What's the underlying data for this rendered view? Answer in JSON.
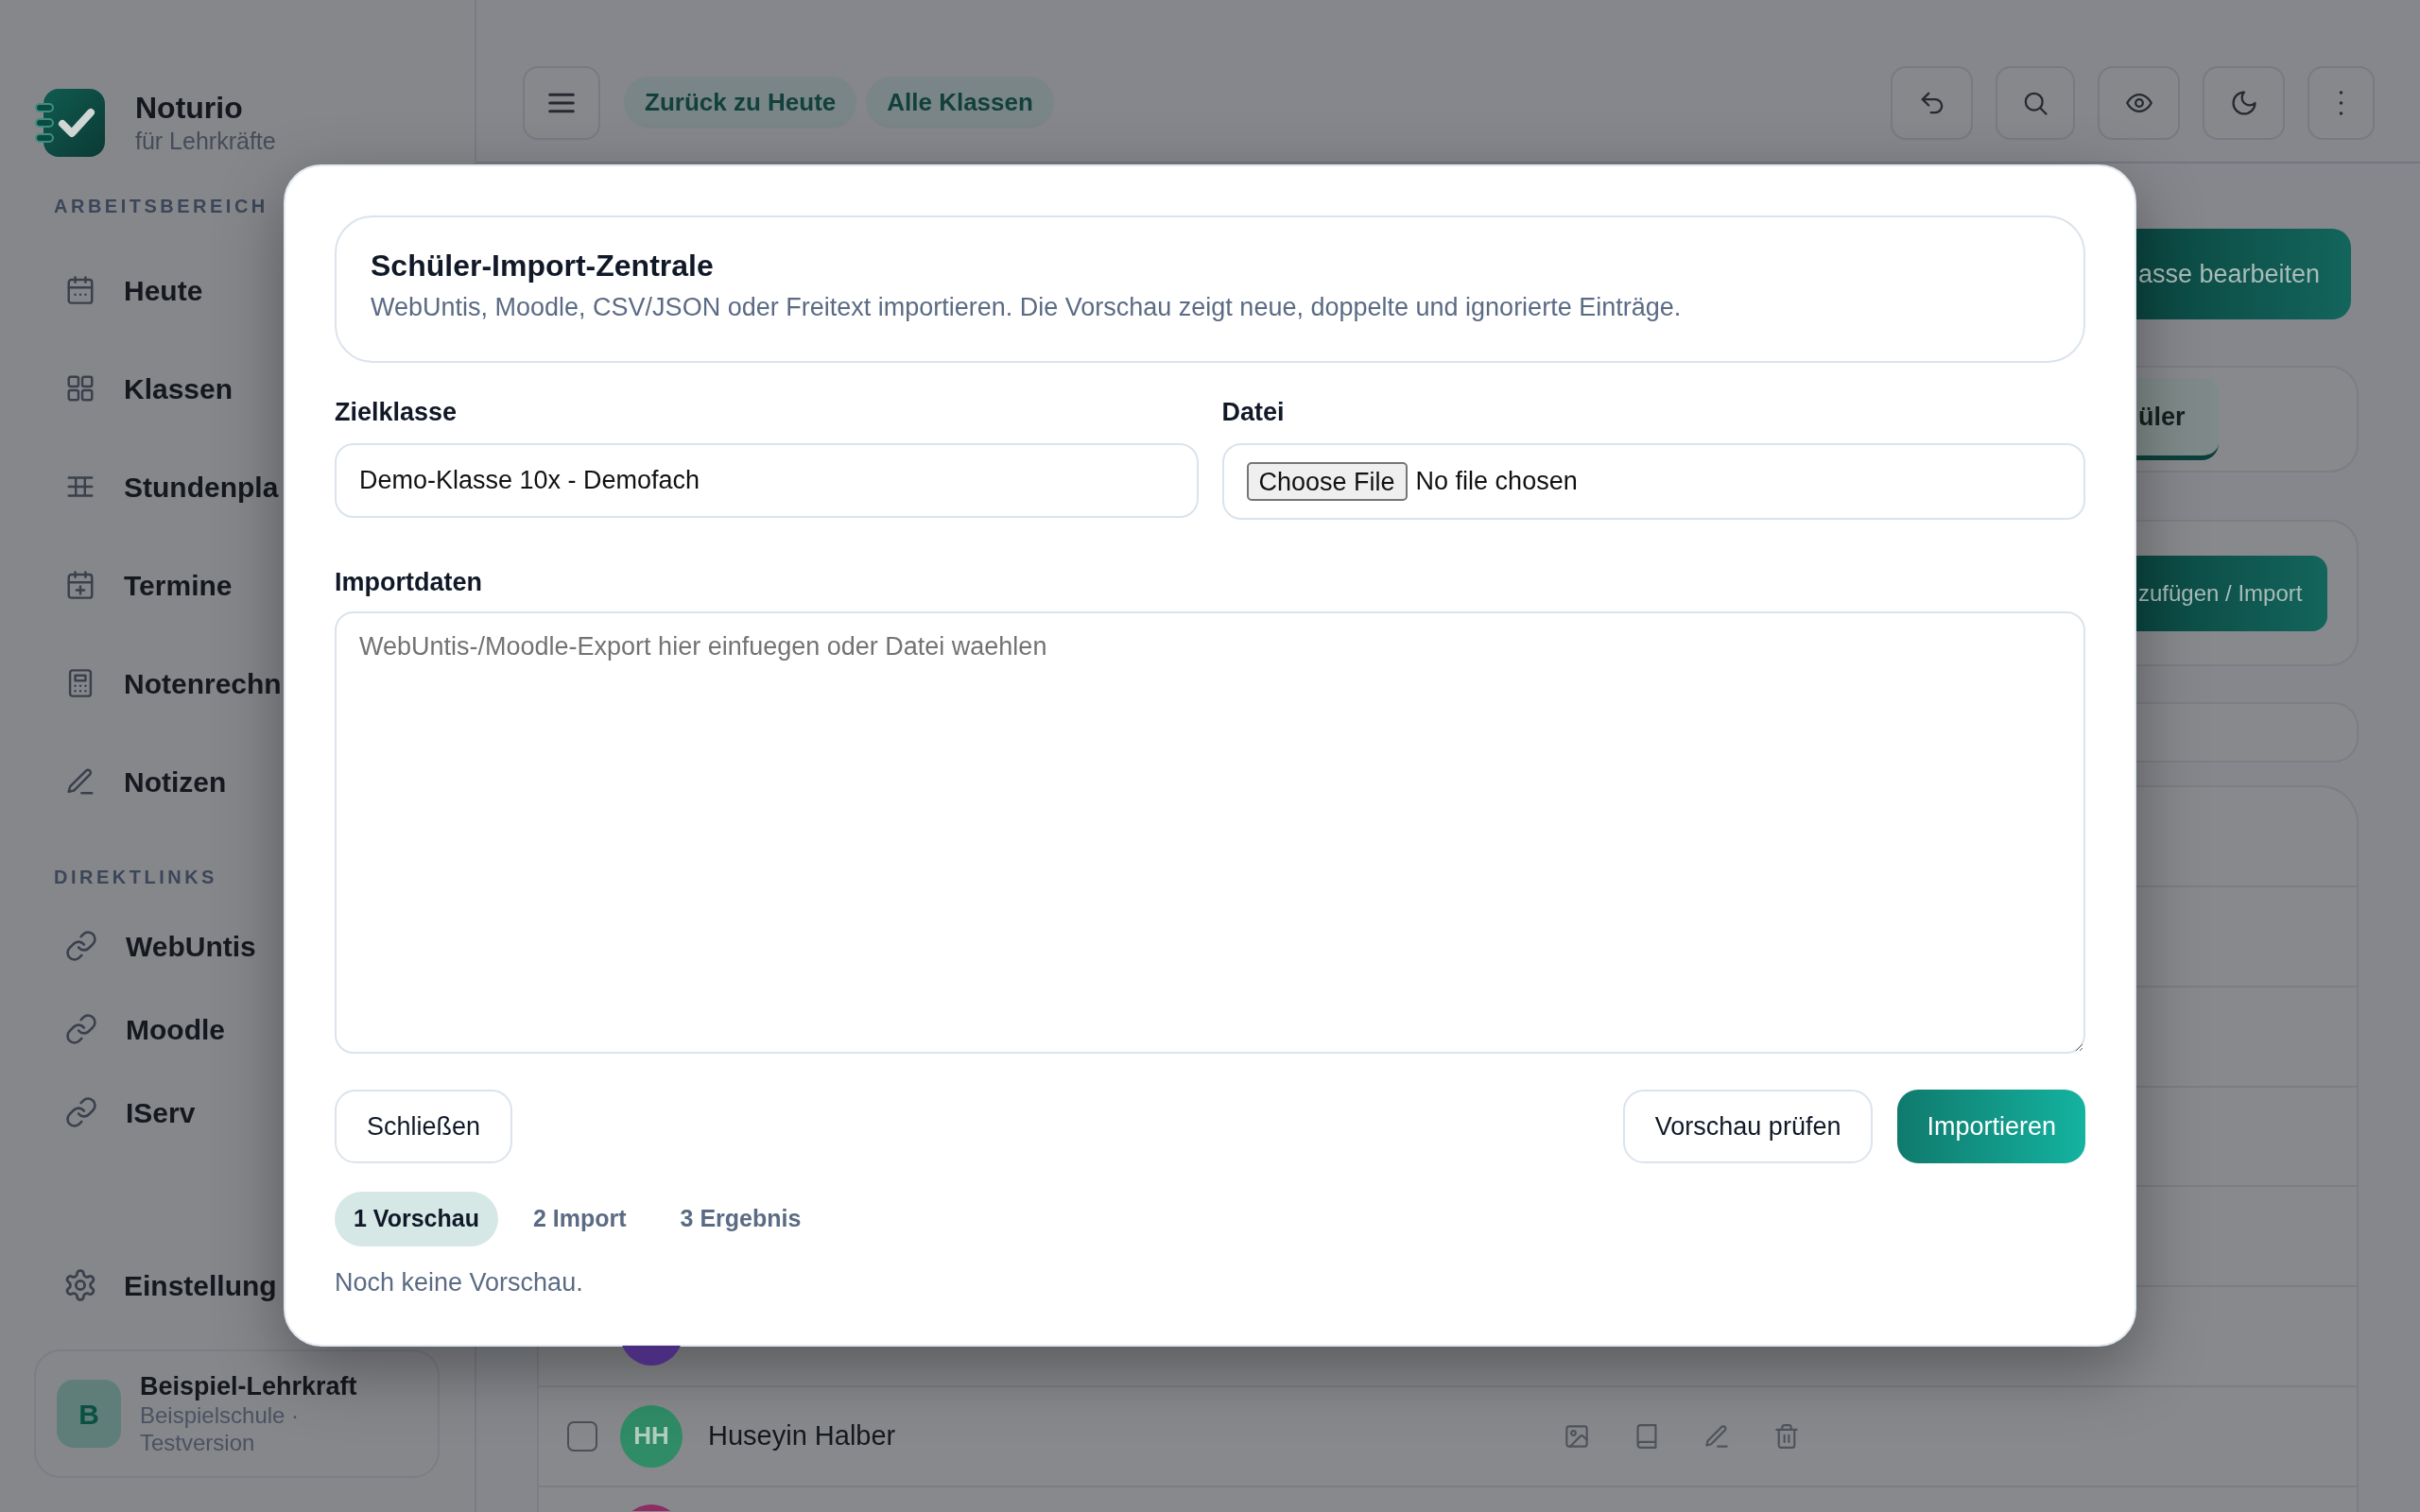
{
  "sidebar": {
    "brand": {
      "name": "Noturio",
      "tagline": "für Lehrkräfte"
    },
    "sections": [
      {
        "heading": "ARBEITSBEREICH",
        "items": [
          {
            "label": "Heute",
            "selected": false
          },
          {
            "label": "Klassen",
            "selected": false
          },
          {
            "label": "Stundenpla",
            "selected": false
          },
          {
            "label": "Termine",
            "selected": false
          },
          {
            "label": "Notenrechn",
            "selected": false
          },
          {
            "label": "Notizen",
            "selected": false
          }
        ]
      },
      {
        "heading": "DIREKTLINKS",
        "items": [
          {
            "label": "WebUntis",
            "selected": false
          },
          {
            "label": "Moodle",
            "selected": false
          },
          {
            "label": "IServ",
            "selected": false
          }
        ]
      }
    ],
    "settings": {
      "label": "Einstellung"
    },
    "user": {
      "initial": "B",
      "name": "Beispiel-Lehrkraft",
      "school": "Beispielschule ·",
      "plan": "Testversion"
    }
  },
  "top_bar": {
    "chips": [
      "Zurück zu Heute",
      "Alle Klassen"
    ]
  },
  "class_page": {
    "edit_button": "asse bearbeiten",
    "tabs": [
      {
        "label": "üler",
        "selected": true
      }
    ],
    "add_button": "zufügen / Import",
    "student_rows": [
      {
        "kind": "cut_top",
        "color": "#4b2d7f"
      },
      {
        "kind": "full",
        "checked": false,
        "initials": "HH",
        "name": "Huseyin Halber",
        "color": "#2f8c66"
      },
      {
        "kind": "cut_bottom",
        "color": "#8c2d66"
      }
    ]
  },
  "modal": {
    "title": "Schüler-Import-Zentrale",
    "subtitle": "WebUntis, Moodle, CSV/JSON oder Freitext importieren. Die Vorschau zeigt neue, doppelte und ignorierte Einträge.",
    "target_class": {
      "label": "Zielklasse",
      "value": "Demo-Klasse 10x - Demofach"
    },
    "file": {
      "label": "Datei",
      "button": "Choose File",
      "status": "No file chosen"
    },
    "import_data": {
      "label": "Importdaten",
      "placeholder": "WebUntis-/Moodle-Export hier einfuegen oder Datei waehlen"
    },
    "close_button": "Schließen",
    "actions": [
      {
        "label": "Vorschau prüfen",
        "kind": "outline"
      },
      {
        "label": "Importieren",
        "kind": "primary"
      }
    ],
    "steps": [
      {
        "label": "1 Vorschau",
        "selected": true
      },
      {
        "label": "2 Import",
        "selected": false
      },
      {
        "label": "3 Ergebnis",
        "selected": false
      }
    ],
    "status": "Noch keine Vorschau."
  }
}
